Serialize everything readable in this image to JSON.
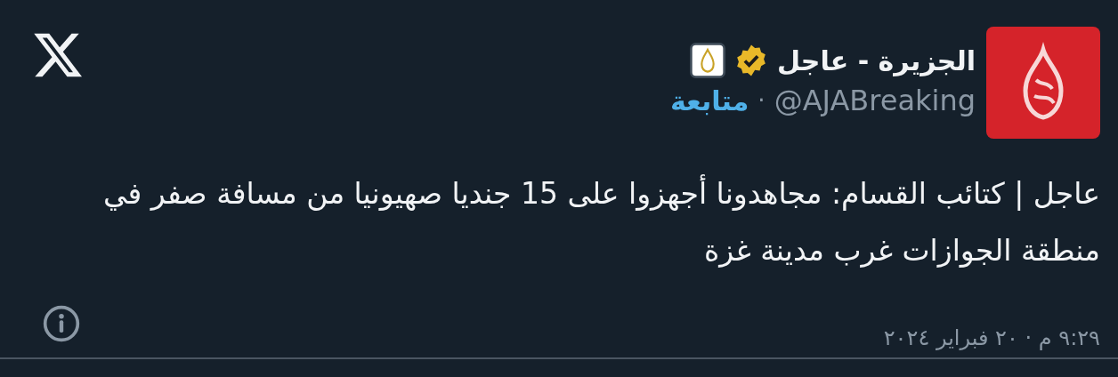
{
  "author": {
    "name": "الجزيرة - عاجل",
    "verified": true,
    "handle": "@AJABreaking",
    "separator": "·",
    "follow": "متابعة"
  },
  "tweet": {
    "text": "عاجل | كتائب القسام: مجاهدونا أجهزوا على 15 جنديا صهيونيا من مسافة صفر في منطقة الجوازات غرب مدينة غزة",
    "time": "٩:٢٩ م · ٢٠ فبراير ٢٠٢٤"
  }
}
